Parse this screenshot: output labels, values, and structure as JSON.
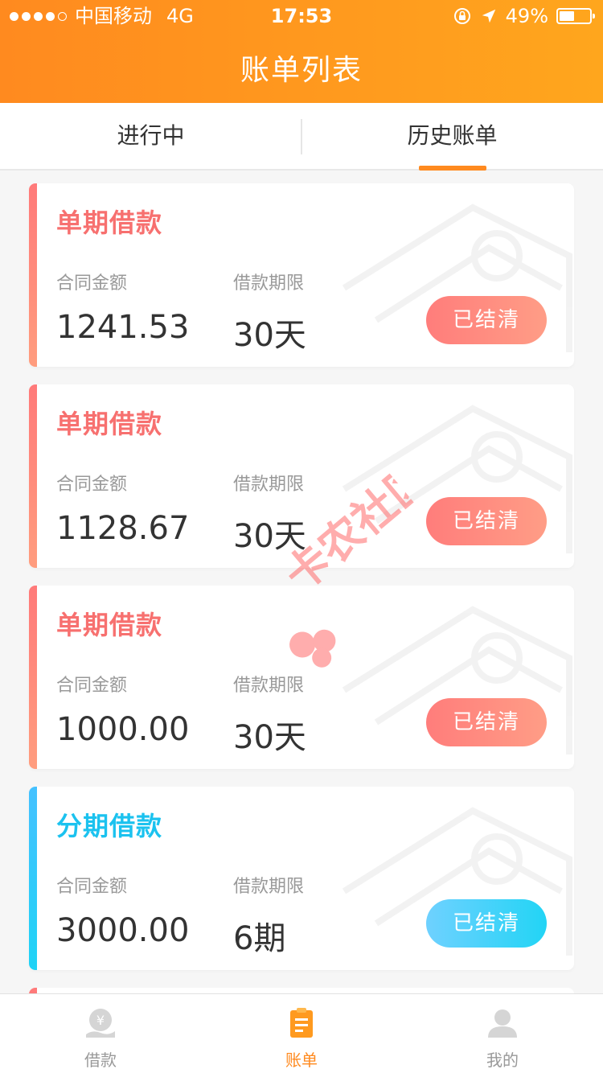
{
  "status_bar": {
    "carrier": "中国移动",
    "network": "4G",
    "time": "17:53",
    "battery": "49%"
  },
  "nav": {
    "title": "账单列表"
  },
  "tabs": [
    {
      "label": "进行中",
      "active": false
    },
    {
      "label": "历史账单",
      "active": true
    }
  ],
  "cards": [
    {
      "title": "单期借款",
      "theme": "red",
      "amount_label": "合同金额",
      "amount": "1241.53",
      "term_label": "借款期限",
      "term": "30天",
      "status": "已结清"
    },
    {
      "title": "单期借款",
      "theme": "red",
      "amount_label": "合同金额",
      "amount": "1128.67",
      "term_label": "借款期限",
      "term": "30天",
      "status": "已结清"
    },
    {
      "title": "单期借款",
      "theme": "red",
      "amount_label": "合同金额",
      "amount": "1000.00",
      "term_label": "借款期限",
      "term": "30天",
      "status": "已结清"
    },
    {
      "title": "分期借款",
      "theme": "blue",
      "amount_label": "合同金额",
      "amount": "3000.00",
      "term_label": "借款期限",
      "term": "6期",
      "status": "已结清"
    }
  ],
  "watermark": {
    "text": "卡农社区"
  },
  "tabbar": [
    {
      "label": "借款",
      "icon": "yen-coin-icon",
      "active": false
    },
    {
      "label": "账单",
      "icon": "bill-clipboard-icon",
      "active": true
    },
    {
      "label": "我的",
      "icon": "user-profile-icon",
      "active": false
    }
  ],
  "colors": {
    "brand_orange": "#ff8a1f",
    "single_loan_red": "#f7706f",
    "installment_blue": "#1bc2ef"
  }
}
